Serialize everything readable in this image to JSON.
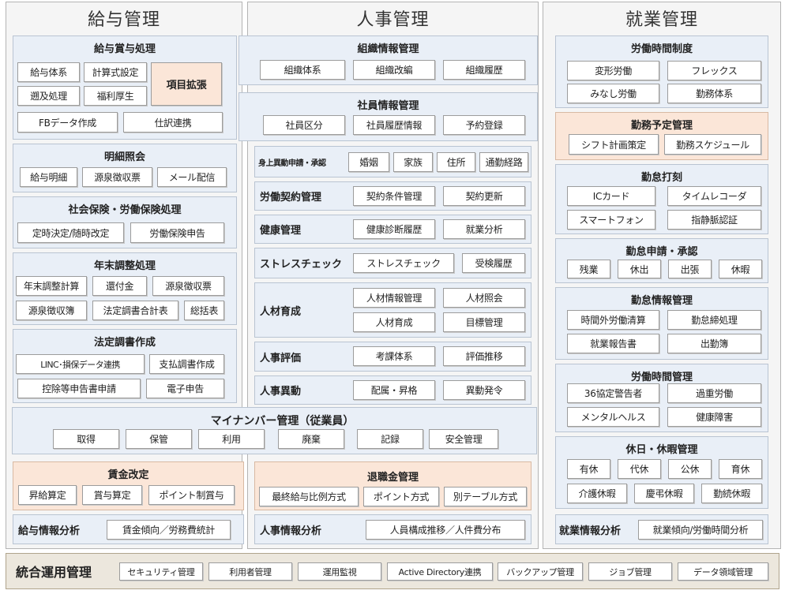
{
  "payroll": {
    "title": "給与管理",
    "processing": {
      "title": "給与賞与処理",
      "items": [
        "給与体系",
        "計算式設定",
        "遡及処理",
        "福利厚生",
        "FBデータ作成",
        "仕訳連携"
      ],
      "highlight": "項目拡張"
    },
    "statement": {
      "title": "明細照会",
      "items": [
        "給与明細",
        "源泉徴収票",
        "メール配信"
      ]
    },
    "insurance": {
      "title": "社会保険・労働保険処理",
      "items": [
        "定時決定/随時改定",
        "労働保険申告"
      ]
    },
    "year_end": {
      "title": "年末調整処理",
      "items": [
        "年末調整計算",
        "還付金",
        "源泉徴収票",
        "源泉徴収簿",
        "法定調書合計表",
        "総括表"
      ]
    },
    "legal": {
      "title": "法定調書作成",
      "items": [
        "LINC･損保データ連携",
        "支払調書作成",
        "控除等申告書申請",
        "電子申告"
      ]
    },
    "wage_revision": {
      "title": "賃金改定",
      "items": [
        "昇給算定",
        "賞与算定",
        "ポイント制賞与"
      ]
    },
    "analysis": {
      "title": "給与情報分析",
      "item": "賃金傾向／労務費統計"
    }
  },
  "hr": {
    "title": "人事管理",
    "org": {
      "title": "組織情報管理",
      "items": [
        "組織体系",
        "組織改編",
        "組織履歴"
      ]
    },
    "employee": {
      "title": "社員情報管理",
      "items": [
        "社員区分",
        "社員履歴情報",
        "予約登録"
      ]
    },
    "rows": [
      {
        "label": "身上異動申請・承認",
        "items": [
          "婚姻",
          "家族",
          "住所",
          "通勤経路"
        ]
      },
      {
        "label": "労働契約管理",
        "items": [
          "契約条件管理",
          "契約更新"
        ]
      },
      {
        "label": "健康管理",
        "items": [
          "健康診断履歴",
          "就業分析"
        ]
      },
      {
        "label": "ストレスチェック",
        "items": [
          "ストレスチェック",
          "受検履歴"
        ]
      },
      {
        "label": "人材育成",
        "items": [
          "人材情報管理",
          "人材照会",
          "人材育成",
          "目標管理"
        ]
      },
      {
        "label": "人事評価",
        "items": [
          "考課体系",
          "評価推移"
        ]
      },
      {
        "label": "人事異動",
        "items": [
          "配属・昇格",
          "異動発令"
        ]
      }
    ],
    "retirement": {
      "title": "退職金管理",
      "items": [
        "最終給与比例方式",
        "ポイント方式",
        "別テーブル方式"
      ]
    },
    "analysis": {
      "title": "人事情報分析",
      "item": "人員構成推移／人件費分布"
    }
  },
  "mynumber": {
    "title": "マイナンバー管理（従業員）",
    "items": [
      "取得",
      "保管",
      "利用",
      "廃棄",
      "記録",
      "安全管理"
    ]
  },
  "work": {
    "title": "就業管理",
    "hours_system": {
      "title": "労働時間制度",
      "items": [
        "変形労働",
        "フレックス",
        "みなし労働",
        "勤務体系"
      ]
    },
    "schedule": {
      "title": "勤務予定管理",
      "items": [
        "シフト計画策定",
        "勤務スケジュール"
      ]
    },
    "clock": {
      "title": "勤怠打刻",
      "items": [
        "ICカード",
        "タイムレコーダ",
        "スマートフォン",
        "指静脈認証"
      ]
    },
    "request": {
      "title": "勤怠申請・承認",
      "items": [
        "残業",
        "休出",
        "出張",
        "休暇"
      ]
    },
    "attendance": {
      "title": "勤怠情報管理",
      "items": [
        "時間外労働清算",
        "勤怠締処理",
        "就業報告書",
        "出勤簿"
      ]
    },
    "hours_mgmt": {
      "title": "労働時間管理",
      "items": [
        "36協定警告者",
        "過重労働",
        "メンタルヘルス",
        "健康障害"
      ]
    },
    "leave": {
      "title": "休日・休暇管理",
      "items": [
        "有休",
        "代休",
        "公休",
        "育休",
        "介護休暇",
        "慶弔休暇",
        "勤続休暇"
      ]
    },
    "analysis": {
      "title": "就業情報分析",
      "item": "就業傾向/労働時間分析"
    }
  },
  "integrated": {
    "title": "統合運用管理",
    "items": [
      "セキュリティ管理",
      "利用者管理",
      "運用監視",
      "Active Directory連携",
      "バックアップ管理",
      "ジョブ管理",
      "データ領域管理"
    ]
  }
}
